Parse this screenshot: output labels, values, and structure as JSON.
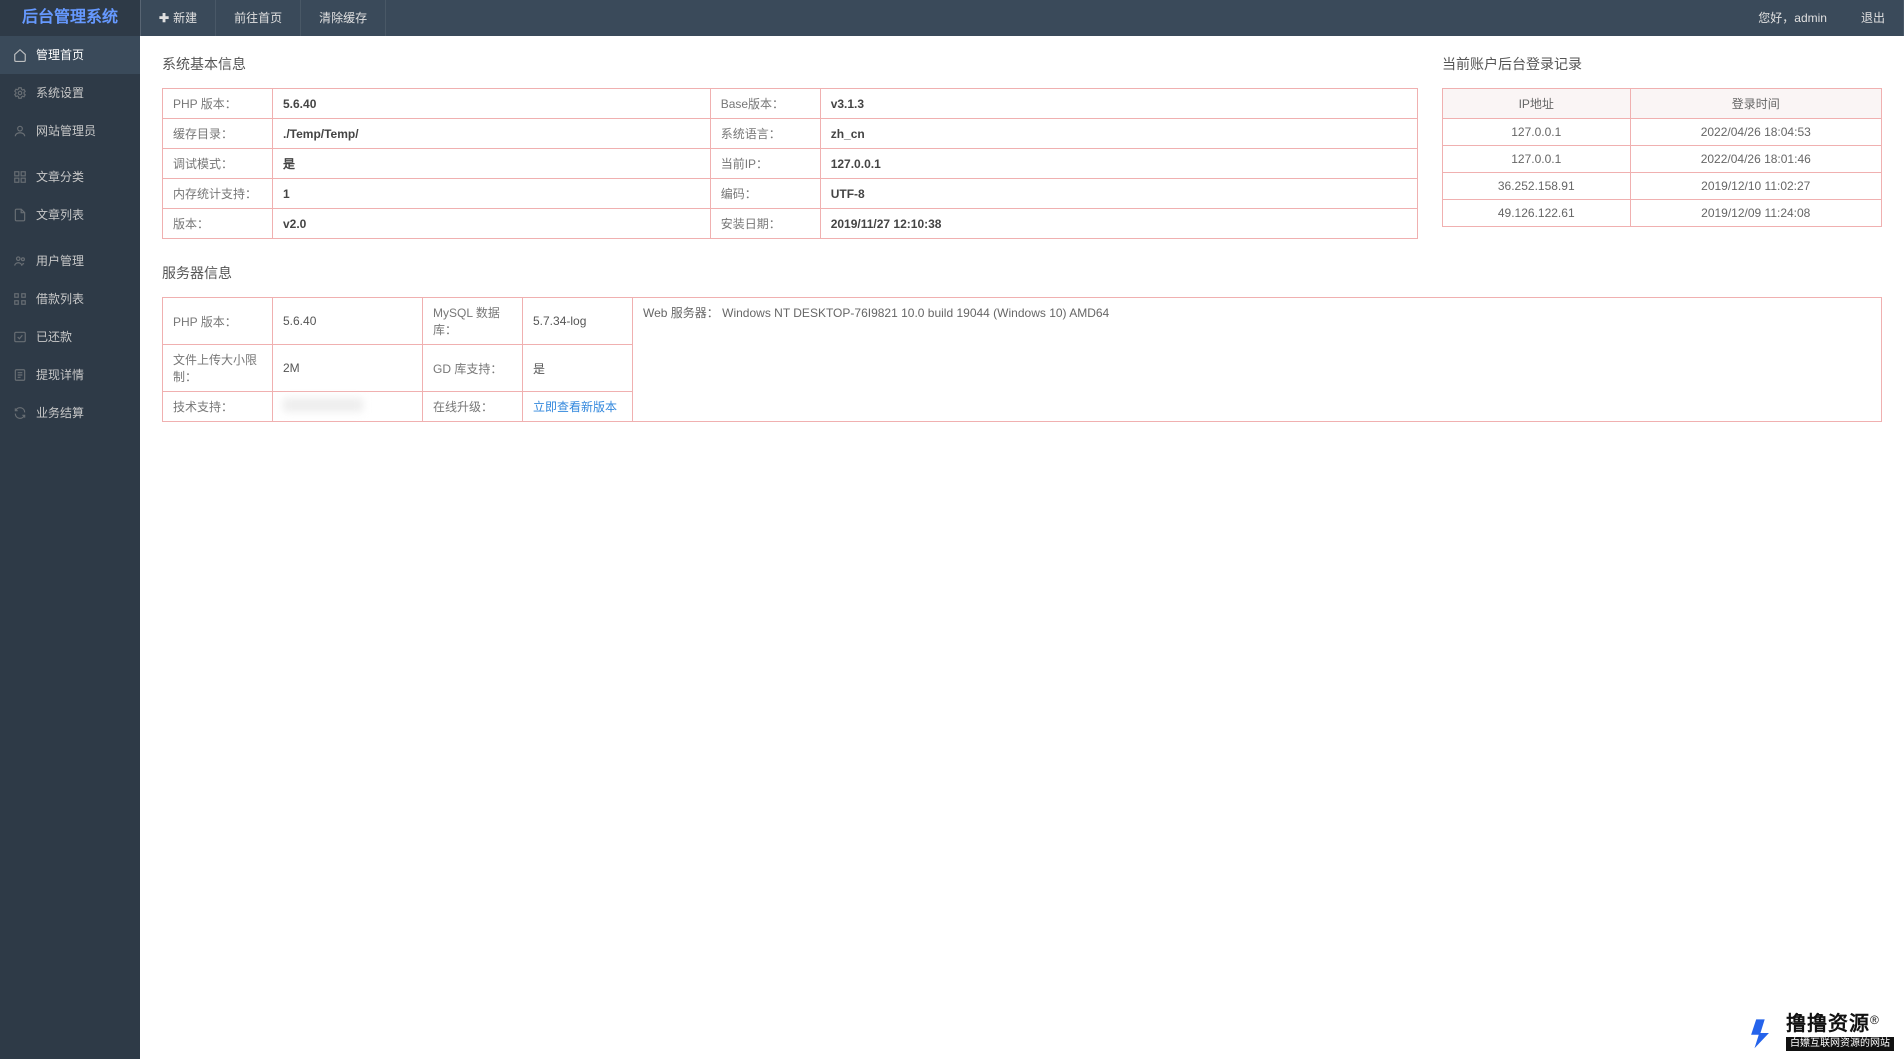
{
  "app": {
    "title": "后台管理系统"
  },
  "topbar": {
    "new": "新建",
    "home": "前往首页",
    "clear": "清除缓存",
    "greeting": "您好，admin",
    "logout": "退出"
  },
  "sidebar": {
    "items": [
      {
        "id": "dashboard",
        "label": "管理首页",
        "icon": "home"
      },
      {
        "id": "settings",
        "label": "系统设置",
        "icon": "gear"
      },
      {
        "id": "site-admin",
        "label": "网站管理员",
        "icon": "user"
      },
      {
        "id": "article-cat",
        "label": "文章分类",
        "icon": "grid"
      },
      {
        "id": "article-list",
        "label": "文章列表",
        "icon": "doc"
      },
      {
        "id": "user-mgmt",
        "label": "用户管理",
        "icon": "users"
      },
      {
        "id": "loan-list",
        "label": "借款列表",
        "icon": "list"
      },
      {
        "id": "repaid",
        "label": "已还款",
        "icon": "check"
      },
      {
        "id": "withdraw-detail",
        "label": "提现详情",
        "icon": "sheet"
      },
      {
        "id": "biz-settle",
        "label": "业务结算",
        "icon": "refresh"
      }
    ]
  },
  "sections": {
    "basic_title": "系统基本信息",
    "login_title": "当前账户后台登录记录",
    "server_title": "服务器信息"
  },
  "basic": {
    "rows": [
      {
        "l1": "PHP 版本：",
        "v1": "5.6.40",
        "l2": "Base版本：",
        "v2": "v3.1.3"
      },
      {
        "l1": "缓存目录：",
        "v1": "./Temp/Temp/",
        "l2": "系统语言：",
        "v2": "zh_cn"
      },
      {
        "l1": "调试模式：",
        "v1": "是",
        "l2": "当前IP：",
        "v2": "127.0.0.1"
      },
      {
        "l1": "内存统计支持：",
        "v1": "1",
        "l2": "编码：",
        "v2": "UTF-8"
      },
      {
        "l1": "版本：",
        "v1": "v2.0",
        "l2": "安装日期：",
        "v2": "2019/11/27 12:10:38"
      }
    ]
  },
  "login": {
    "headers": {
      "ip": "IP地址",
      "time": "登录时间"
    },
    "rows": [
      {
        "ip": "127.0.0.1",
        "time": "2022/04/26 18:04:53"
      },
      {
        "ip": "127.0.0.1",
        "time": "2022/04/26 18:01:46"
      },
      {
        "ip": "36.252.158.91",
        "time": "2019/12/10 11:02:27"
      },
      {
        "ip": "49.126.122.61",
        "time": "2019/12/09 11:24:08"
      }
    ]
  },
  "server": {
    "php_label": "PHP 版本：",
    "php_val": "5.6.40",
    "mysql_label": "MySQL 数据库：",
    "mysql_val": "5.7.34-log",
    "upload_label": "文件上传大小限制：",
    "upload_val": "2M",
    "gd_label": "GD 库支持：",
    "gd_val": "是",
    "web_label": "Web 服务器：",
    "web_val": "Windows NT DESKTOP-76I9821 10.0 build 19044 (Windows 10) AMD64",
    "support_label": "技术支持：",
    "upgrade_label": "在线升级：",
    "upgrade_link": "立即查看新版本"
  },
  "watermark": {
    "title": "撸撸资源",
    "sup": "®",
    "sub": "白嫖互联网资源的网站"
  }
}
